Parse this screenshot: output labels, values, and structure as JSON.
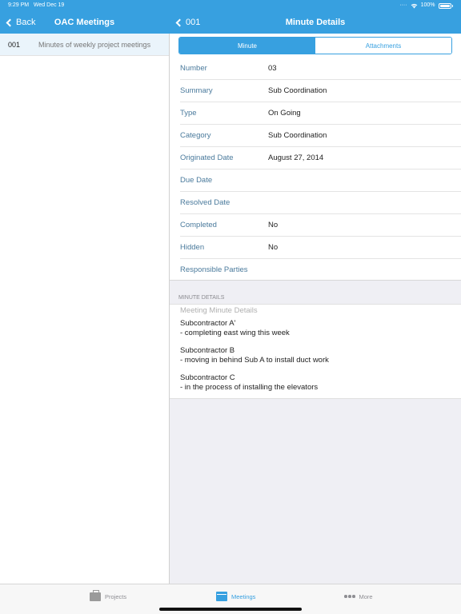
{
  "status_bar": {
    "time": "9:29 PM",
    "date": "Wed Dec 19",
    "battery": "100%"
  },
  "left_nav": {
    "back_label": "Back",
    "title": "OAC Meetings"
  },
  "right_nav": {
    "back_label": "001",
    "title": "Minute Details"
  },
  "meetings_list": [
    {
      "number": "001",
      "title": "Minutes of weekly project meetings",
      "selected": true
    }
  ],
  "segments": [
    {
      "label": "Minute",
      "active": true
    },
    {
      "label": "Attachments",
      "active": false
    }
  ],
  "fields": [
    {
      "label": "Number",
      "value": "03"
    },
    {
      "label": "Summary",
      "value": "Sub Coordination"
    },
    {
      "label": "Type",
      "value": "On Going"
    },
    {
      "label": "Category",
      "value": "Sub Coordination"
    },
    {
      "label": "Originated Date",
      "value": "August 27, 2014"
    },
    {
      "label": "Due Date",
      "value": ""
    },
    {
      "label": "Resolved Date",
      "value": ""
    },
    {
      "label": "Completed",
      "value": "No"
    },
    {
      "label": "Hidden",
      "value": "No"
    },
    {
      "label": "Responsible Parties",
      "value": ""
    }
  ],
  "minute_details": {
    "section_header": "MINUTE DETAILS",
    "placeholder": "Meeting Minute Details",
    "notes": [
      {
        "line1": "Subcontractor A'",
        "line2": "- completing east wing this week"
      },
      {
        "line1": "Subcontractor B",
        "line2": "- moving in behind Sub A to install duct work"
      },
      {
        "line1": "Subcontractor C",
        "line2": "- in the process of installing the elevators"
      }
    ]
  },
  "tab_bar": [
    {
      "label": "Projects",
      "icon": "briefcase-icon",
      "active": false
    },
    {
      "label": "Meetings",
      "icon": "meetings-icon",
      "active": true
    },
    {
      "label": "More",
      "icon": "more-dots-icon",
      "active": false
    }
  ],
  "colors": {
    "accent": "#37a0e0",
    "label": "#4a7a9c",
    "background": "#efeff4"
  }
}
